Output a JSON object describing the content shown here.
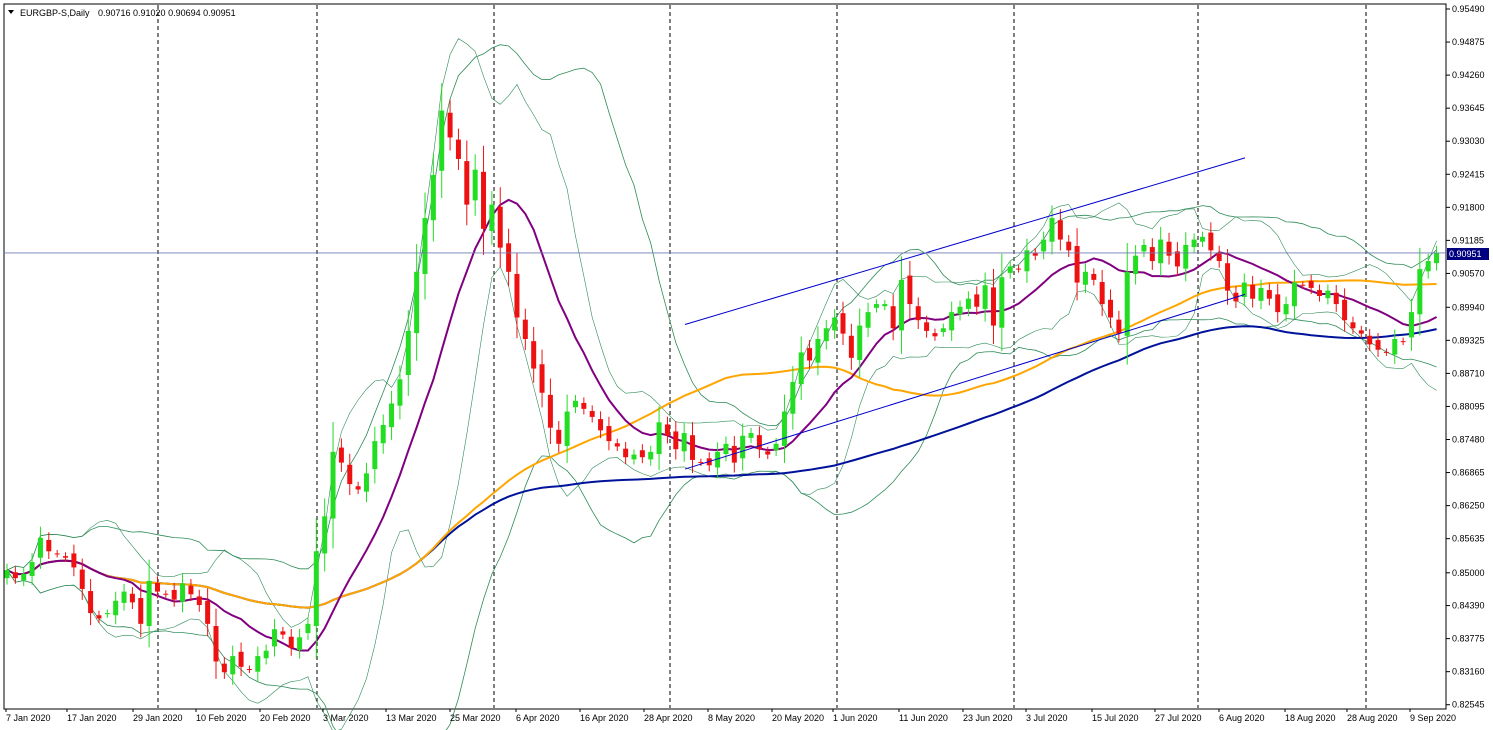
{
  "header": {
    "symbol": "EURGBP-S,Daily",
    "ohlc": "0.90716 0.91020 0.90694 0.90951"
  },
  "colors": {
    "bull": "#22dd22",
    "bear": "#ee1111",
    "ma_fast": "#800080",
    "ma_mid": "#ffa500",
    "ma_slow": "#00129a",
    "bollinger": "#2e8b57",
    "trendline": "#0000cc",
    "price_line": "#6f7bb0"
  },
  "chart_data": {
    "type": "candlestick",
    "title": "EURGBP-S,Daily",
    "ylim": [
      0.8254,
      0.9549
    ],
    "y_ticks": [
      "0.95490",
      "0.94875",
      "0.94260",
      "0.93645",
      "0.93030",
      "0.92415",
      "0.91800",
      "0.91185",
      "0.90570",
      "0.89940",
      "0.89325",
      "0.88710",
      "0.88095",
      "0.87480",
      "0.86865",
      "0.86250",
      "0.85635",
      "0.85000",
      "0.84390",
      "0.83775",
      "0.83160",
      "0.82545"
    ],
    "x_ticks": [
      "7 Jan 2020",
      "17 Jan 2020",
      "29 Jan 2020",
      "10 Feb 2020",
      "20 Feb 2020",
      "3 Mar 2020",
      "13 Mar 2020",
      "25 Mar 2020",
      "6 Apr 2020",
      "16 Apr 2020",
      "28 Apr 2020",
      "8 May 2020",
      "20 May 2020",
      "1 Jun 2020",
      "11 Jun 2020",
      "23 Jun 2020",
      "3 Jul 2020",
      "15 Jul 2020",
      "27 Jul 2020",
      "6 Aug 2020",
      "18 Aug 2020",
      "28 Aug 2020",
      "9 Sep 2020"
    ],
    "current_price": "0.90951",
    "current_price_value": 0.90951,
    "candle_closes": [
      0.8505,
      0.849,
      0.8498,
      0.852,
      0.8565,
      0.854,
      0.8535,
      0.8528,
      0.851,
      0.847,
      0.8425,
      0.8415,
      0.8425,
      0.8448,
      0.8465,
      0.8445,
      0.8405,
      0.8485,
      0.8465,
      0.846,
      0.845,
      0.848,
      0.846,
      0.844,
      0.8405,
      0.8335,
      0.8315,
      0.8345,
      0.8325,
      0.832,
      0.8345,
      0.8355,
      0.8395,
      0.8385,
      0.836,
      0.838,
      0.8405,
      0.854,
      0.8605,
      0.8725,
      0.8705,
      0.8665,
      0.8655,
      0.8685,
      0.8745,
      0.8775,
      0.8815,
      0.886,
      0.895,
      0.906,
      0.916,
      0.924,
      0.936,
      0.931,
      0.927,
      0.9185,
      0.925,
      0.914,
      0.9185,
      0.9105,
      0.906,
      0.8975,
      0.8935,
      0.888,
      0.8835,
      0.877,
      0.874,
      0.88,
      0.882,
      0.8805,
      0.879,
      0.8765,
      0.8745,
      0.8735,
      0.8715,
      0.872,
      0.8715,
      0.8725,
      0.878,
      0.8755,
      0.873,
      0.876,
      0.871,
      0.8705,
      0.87,
      0.8725,
      0.874,
      0.8705,
      0.8755,
      0.876,
      0.873,
      0.872,
      0.874,
      0.88,
      0.8855,
      0.891,
      0.8895,
      0.8935,
      0.8955,
      0.8975,
      0.8945,
      0.89,
      0.896,
      0.8985,
      0.9,
      0.9,
      0.8955,
      0.9045,
      0.9,
      0.897,
      0.895,
      0.894,
      0.8955,
      0.8985,
      0.8995,
      0.901,
      0.8995,
      0.9035,
      0.896,
      0.905,
      0.907,
      0.9065,
      0.91,
      0.909,
      0.912,
      0.916,
      0.912,
      0.91,
      0.904,
      0.906,
      0.9045,
      0.9,
      0.8975,
      0.8945,
      0.906,
      0.909,
      0.911,
      0.908,
      0.912,
      0.909,
      0.907,
      0.911,
      0.912,
      0.9125,
      0.91,
      0.908,
      0.9025,
      0.9005,
      0.904,
      0.901,
      0.903,
      0.901,
      0.8985,
      0.9,
      0.904,
      0.9035,
      0.903,
      0.9015,
      0.9025,
      0.9,
      0.897,
      0.8955,
      0.8945,
      0.8925,
      0.8915,
      0.891,
      0.8935,
      0.893,
      0.8985,
      0.9065,
      0.908,
      0.9095
    ]
  }
}
